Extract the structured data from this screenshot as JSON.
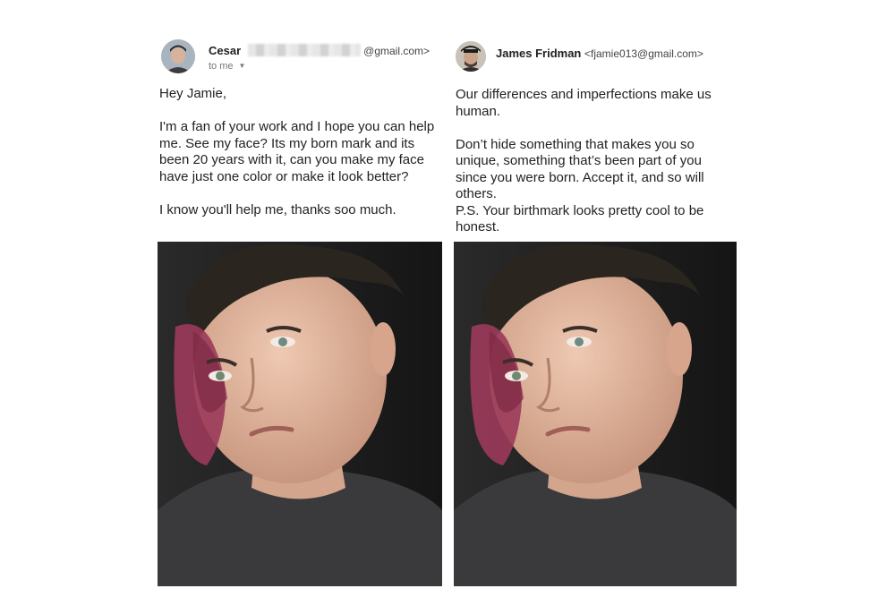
{
  "left_email": {
    "sender_name": "Cesar",
    "sender_email_domain": "@gmail.com>",
    "to_label": "to me",
    "avatar_icon": "user-avatar-icon",
    "body": "Hey Jamie,\n\nI'm a fan of your work and I hope you can help me. See my face? Its my born mark and its been 20 years with it, can you make my face have just one color or make it look better?\n\nI know you'll help me, thanks soo much."
  },
  "right_email": {
    "sender_name": "James Fridman",
    "sender_email": "<fjamie013@gmail.com>",
    "avatar_icon": "user-avatar-icon",
    "body": "Our differences and imperfections make us human.\n\nDon’t hide something that makes you so unique, something that’s been part of you since you were born. Accept it, and so will others.\nP.S. Your birthmark looks pretty cool to be honest."
  },
  "colors": {
    "text": "#222222",
    "birthmark": "#9b3a5a",
    "skin": "#e3b9a2",
    "shirt": "#3a3a3c",
    "photo_background": "#1c1c1c"
  }
}
